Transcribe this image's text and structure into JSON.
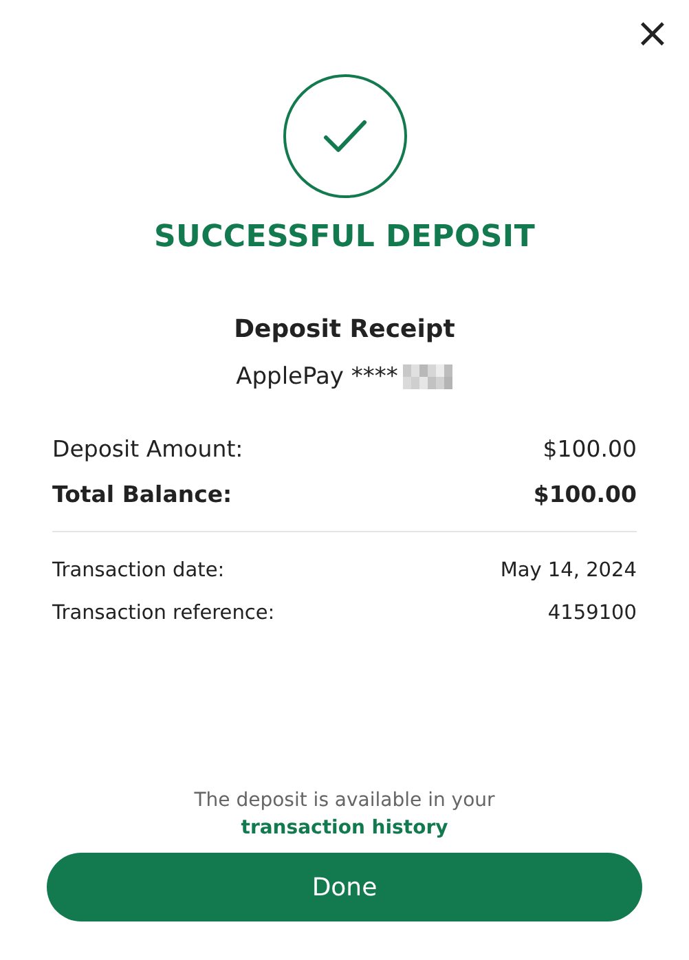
{
  "close": {
    "label": "×"
  },
  "title": "SUCCESSFUL DEPOSIT",
  "receipt": {
    "heading": "Deposit Receipt",
    "method": "ApplePay ****",
    "masked": true
  },
  "amounts": [
    {
      "label": "Deposit Amount:",
      "value": "$100.00",
      "kind": "regular"
    },
    {
      "label": "Total Balance:",
      "value": "$100.00",
      "kind": "total"
    }
  ],
  "details": [
    {
      "label": "Transaction date:",
      "value": "May 14, 2024"
    },
    {
      "label": "Transaction reference:",
      "value": "4159100"
    }
  ],
  "note": {
    "text": "The deposit is available in your",
    "link": "transaction history"
  },
  "button": {
    "label": "Done"
  }
}
